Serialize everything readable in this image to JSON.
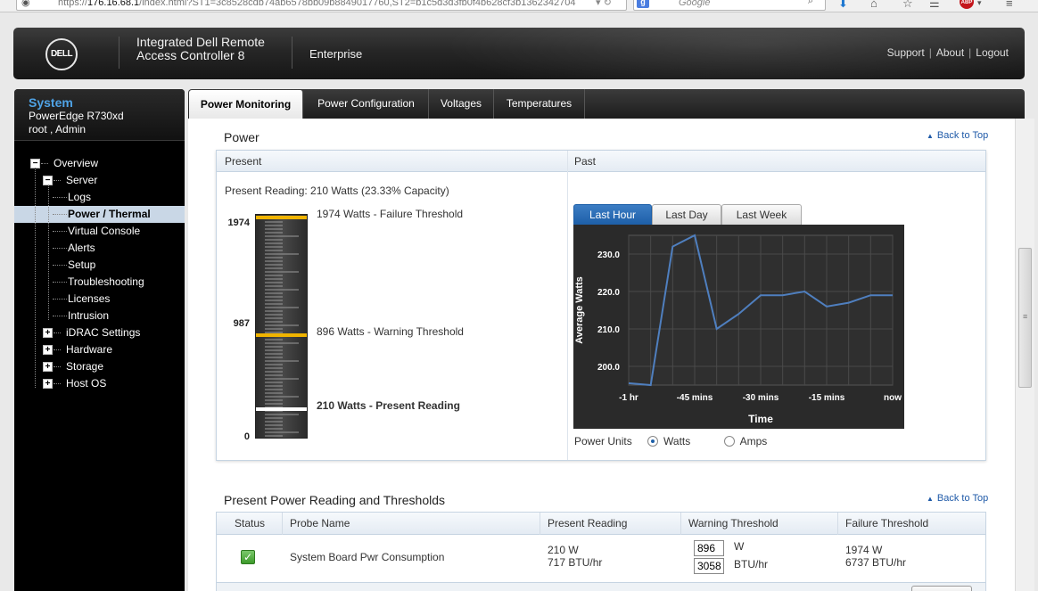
{
  "browser": {
    "url_prefix": "https://",
    "url_host": "176.16.68.1",
    "url_rest": "/index.html?ST1=3c8528cdb74ab6578bb09b8849017760,ST2=b1c5d3d3fb0f4b628cf3b1362342704",
    "search_placeholder": "Google",
    "search_engine_letter": "g",
    "adblock_label": "ABP"
  },
  "header": {
    "logo_text": "DELL",
    "product_line1": "Integrated Dell Remote",
    "product_line2": "Access Controller 8",
    "edition": "Enterprise",
    "links": [
      "Support",
      "About",
      "Logout"
    ]
  },
  "system": {
    "title": "System",
    "model": "PowerEdge R730xd",
    "user": "root , Admin"
  },
  "tree": [
    {
      "label": "Overview",
      "level": 0,
      "toggle": "−"
    },
    {
      "label": "Server",
      "level": 1,
      "toggle": "−"
    },
    {
      "label": "Logs",
      "level": 2,
      "toggle": ""
    },
    {
      "label": "Power / Thermal",
      "level": 2,
      "toggle": "",
      "selected": true
    },
    {
      "label": "Virtual Console",
      "level": 2,
      "toggle": ""
    },
    {
      "label": "Alerts",
      "level": 2,
      "toggle": ""
    },
    {
      "label": "Setup",
      "level": 2,
      "toggle": ""
    },
    {
      "label": "Troubleshooting",
      "level": 2,
      "toggle": ""
    },
    {
      "label": "Licenses",
      "level": 2,
      "toggle": ""
    },
    {
      "label": "Intrusion",
      "level": 2,
      "toggle": ""
    },
    {
      "label": "iDRAC Settings",
      "level": 1,
      "toggle": "+"
    },
    {
      "label": "Hardware",
      "level": 1,
      "toggle": "+"
    },
    {
      "label": "Storage",
      "level": 1,
      "toggle": "+"
    },
    {
      "label": "Host OS",
      "level": 1,
      "toggle": "+"
    }
  ],
  "tabs": [
    "Power Monitoring",
    "Power Configuration",
    "Voltages",
    "Temperatures"
  ],
  "power": {
    "section_title": "Power",
    "back_to_top": "Back to Top",
    "present_header": "Present",
    "past_header": "Past",
    "present_reading_text": "Present Reading: 210 Watts (23.33% Capacity)",
    "gauge": {
      "max": 1974,
      "mid_label": "987",
      "max_label": "1974",
      "min_label": "0",
      "failure_watts": 1974,
      "warning_watts": 896,
      "present_watts": 210,
      "failure_text": "1974 Watts - Failure Threshold",
      "warning_text": "896 Watts - Warning Threshold",
      "present_text": "210 Watts - Present Reading",
      "failure_color": "#f0b400",
      "warning_color": "#f0b400",
      "present_color": "#ffffff"
    },
    "chart_tabs": [
      "Last Hour",
      "Last Day",
      "Last Week"
    ],
    "power_units_label": "Power Units",
    "unit_options": [
      "Watts",
      "Amps"
    ],
    "selected_unit": "Watts"
  },
  "chart_data": {
    "type": "line",
    "title": "",
    "xlabel": "Time",
    "ylabel": "Average Watts",
    "x_ticks": [
      "-1 hr",
      "-45 mins",
      "-30 mins",
      "-15 mins",
      "now"
    ],
    "y_ticks": [
      "200.0",
      "210.0",
      "220.0",
      "230.0"
    ],
    "xlim": [
      -60,
      0
    ],
    "ylim": [
      195,
      235
    ],
    "grid": true,
    "line_color": "#4f7fbf",
    "series": [
      {
        "x": [
          -60,
          -55,
          -50,
          -45,
          -40,
          -35,
          -30,
          -25,
          -20,
          -15,
          -10,
          -5,
          0
        ],
        "y": [
          195.5,
          195,
          232,
          235.5,
          210,
          214,
          219,
          219,
          220,
          216,
          217,
          219,
          219
        ]
      }
    ]
  },
  "thresholds": {
    "section_title": "Present Power Reading and Thresholds",
    "back_to_top": "Back to Top",
    "columns": [
      "Status",
      "Probe Name",
      "Present Reading",
      "Warning Threshold",
      "Failure Threshold"
    ],
    "rows": [
      {
        "status": "ok",
        "probe": "System Board Pwr Consumption",
        "present_w": "210 W",
        "present_btu": "717 BTU/hr",
        "warning_w_value": "896",
        "warning_w_unit": "W",
        "warning_btu_value": "3058",
        "warning_btu_unit": "BTU/hr",
        "failure_w": "1974 W",
        "failure_btu": "6737 BTU/hr"
      }
    ]
  }
}
